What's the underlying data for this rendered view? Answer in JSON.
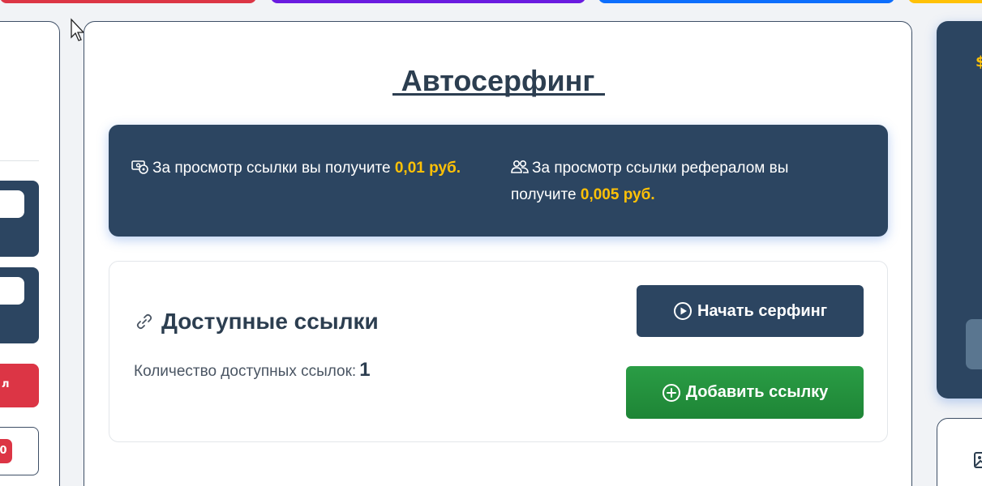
{
  "main": {
    "title": "Автосерфинг",
    "info": {
      "own_text": "За просмотр ссылки вы получите",
      "own_amount": "0,01 руб.",
      "ref_text": "За просмотр ссылки рефералом вы получите",
      "ref_amount": "0,005 руб."
    },
    "links": {
      "title": "Доступные ссылки",
      "count_label": "Количество доступных ссылок:",
      "count_value": "1",
      "start_button": "Начать серфинг",
      "add_button": "Добавить ссылку"
    }
  },
  "left_panel": {
    "red_button_fragment": "л",
    "badge_fragment": "0"
  },
  "right_panel": {
    "icon_fragment": "$"
  },
  "colors": {
    "dark_navy": "#2c4561",
    "highlight": "#ffc107",
    "green": "#28a745",
    "red": "#dc3545"
  }
}
